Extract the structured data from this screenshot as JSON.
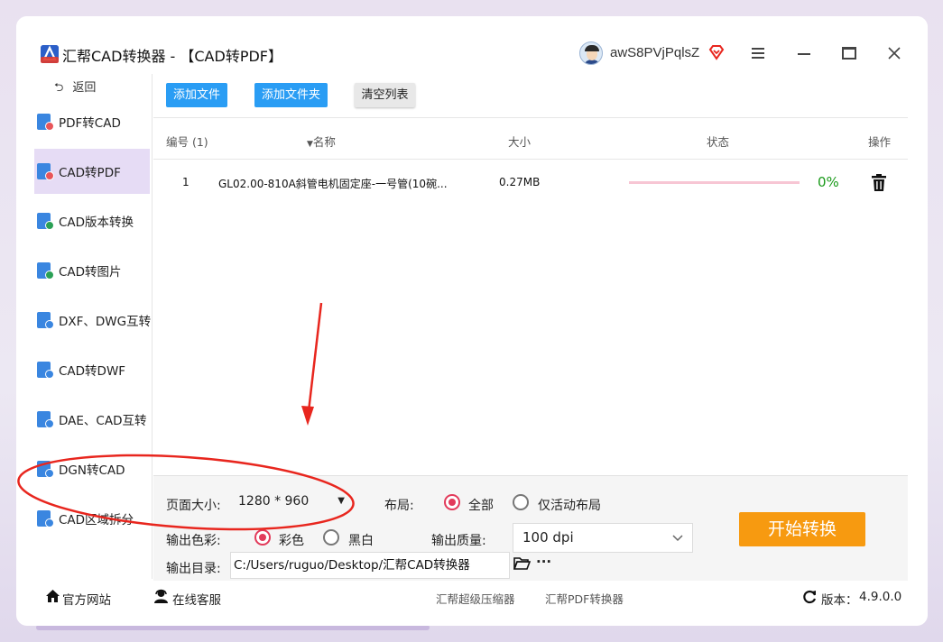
{
  "window": {
    "title": "汇帮CAD转换器 - 【CAD转PDF】",
    "user_name": "awS8PVjPqlsZ"
  },
  "sidebar": {
    "back_label": "返回",
    "items": [
      {
        "label": "PDF转CAD",
        "icon": "pdf-to-cad-icon",
        "badge_color": "#e8555a"
      },
      {
        "label": "CAD转PDF",
        "icon": "cad-to-pdf-icon",
        "badge_color": "#e8555a",
        "active": true
      },
      {
        "label": "CAD版本转换",
        "icon": "cad-version-icon",
        "badge_color": "#2aa055"
      },
      {
        "label": "CAD转图片",
        "icon": "cad-to-image-icon",
        "badge_color": "#2aa055"
      },
      {
        "label": "DXF、DWG互转",
        "icon": "dxf-dwg-icon",
        "badge_color": "#3a86e0"
      },
      {
        "label": "CAD转DWF",
        "icon": "cad-to-dwf-icon",
        "badge_color": "#3a86e0"
      },
      {
        "label": "DAE、CAD互转",
        "icon": "dae-cad-icon",
        "badge_color": "#3a86e0"
      },
      {
        "label": "DGN转CAD",
        "icon": "dgn-to-cad-icon",
        "badge_color": "#3a86e0"
      },
      {
        "label": "CAD区域拆分",
        "icon": "cad-split-icon",
        "badge_color": "#3a86e0"
      }
    ]
  },
  "toolbar": {
    "add_file": "添加文件",
    "add_folder": "添加文件夹",
    "clear_list": "清空列表"
  },
  "table": {
    "headers": {
      "index": "编号 (1)",
      "name": "名称",
      "size": "大小",
      "status": "状态",
      "action": "操作"
    },
    "rows": [
      {
        "index": "1",
        "name": "GL02.00-810A斜管电机固定座-一号管(10碗...",
        "size": "0.27MB",
        "progress": 0,
        "percent": "0%"
      }
    ]
  },
  "settings": {
    "page_size_label": "页面大小:",
    "page_size_value": "1280 * 960",
    "layout_label": "布局:",
    "layout_options": [
      "全部",
      "仅活动布局"
    ],
    "layout_selected": "全部",
    "color_label": "输出色彩:",
    "color_options": [
      "彩色",
      "黑白"
    ],
    "color_selected": "彩色",
    "quality_label": "输出质量:",
    "quality_value": "100 dpi",
    "output_dir_label": "输出目录:",
    "output_dir_value": "C:/Users/ruguo/Desktop/汇帮CAD转换器",
    "more_label": "···",
    "start_button": "开始转换"
  },
  "footer": {
    "website": "官方网站",
    "support": "在线客服",
    "link1": "汇帮超级压缩器",
    "link2": "汇帮PDF转换器",
    "version_label": "版本：",
    "version_value": "4.9.0.0"
  },
  "colors": {
    "accent_blue": "#2a9df4",
    "start_orange": "#f79a10",
    "active_sidebar": "#e6dcf5",
    "radio_red": "#e23a5a",
    "annotation_red": "#e8261e"
  }
}
